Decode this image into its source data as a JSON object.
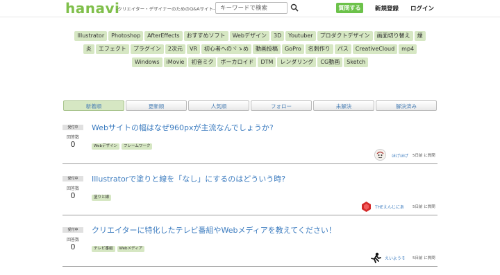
{
  "header": {
    "logo": "hanavi",
    "tagline": "-クリエイター・デザイナーのためのQ&Aサイト-",
    "search_placeholder": "キーワードで検索",
    "ask_button": "質問する",
    "register": "新規登録",
    "login": "ログイン"
  },
  "tags": [
    "Illustrator",
    "Photoshop",
    "AfterEffects",
    "おすすめソフト",
    "Webデザイン",
    "3D",
    "Youtuber",
    "プロダクトデザイン",
    "画面切り替え",
    "煙",
    "炎",
    "エフェクト",
    "プラグイン",
    "2次元",
    "VR",
    "初心者へのヾゝめ",
    "動画投稿",
    "GoPro",
    "名刺作り",
    "パス",
    "CreativeCloud",
    "mp4",
    "Windows",
    "iMovie",
    "初音ミク",
    "ボーカロイド",
    "DTM",
    "レンダリング",
    "CG動画",
    "Sketch"
  ],
  "tabs": [
    "新着順",
    "更新順",
    "人気順",
    "フォロー",
    "未解決",
    "解決済み"
  ],
  "questions": [
    {
      "status": "受付中",
      "count_label": "回答数",
      "count": "0",
      "title": "Webサイトの幅はなぜ960pxが主流なんでしょうか?",
      "tags": [
        "Webデザイン",
        "フレームワーク"
      ],
      "user": "ほげほげ",
      "when": "5日前 に質問"
    },
    {
      "status": "受付中",
      "count_label": "回答数",
      "count": "0",
      "title": "Illustratorで塗りと線を「なし」にするのはどういう時?",
      "tags": [
        "塗りと線"
      ],
      "user": "THEえんじにあ",
      "when": "5日前 に質問"
    },
    {
      "status": "受付中",
      "count_label": "回答数",
      "count": "0",
      "title": "クリエイターに特化したテレビ番組やWebメディアを教えてください！",
      "tags": [
        "テレビ番組",
        "Webメディア"
      ],
      "user": "えいようそ",
      "when": "5日前 に質問"
    }
  ],
  "colors": {
    "brand": "#7fbf4a",
    "tag_bg": "#d6e7c3",
    "link": "#3b7bbf",
    "ask_button": "#6cc24a"
  }
}
